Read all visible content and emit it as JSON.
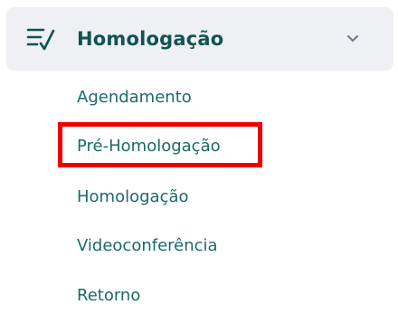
{
  "menu": {
    "group_title": "Homologação",
    "group_icon": "checklist-icon",
    "chevron_icon": "chevron-down-icon",
    "expanded": true,
    "accent_color": "#12534f",
    "item_color": "#1a6a66",
    "header_background": "#eef0f4",
    "highlight_color": "#ee0000",
    "highlighted_item": "Pré-Homologação",
    "items": [
      {
        "label": "Agendamento"
      },
      {
        "label": "Pré-Homologação"
      },
      {
        "label": "Homologação"
      },
      {
        "label": "Videoconferência"
      },
      {
        "label": "Retorno"
      }
    ]
  }
}
